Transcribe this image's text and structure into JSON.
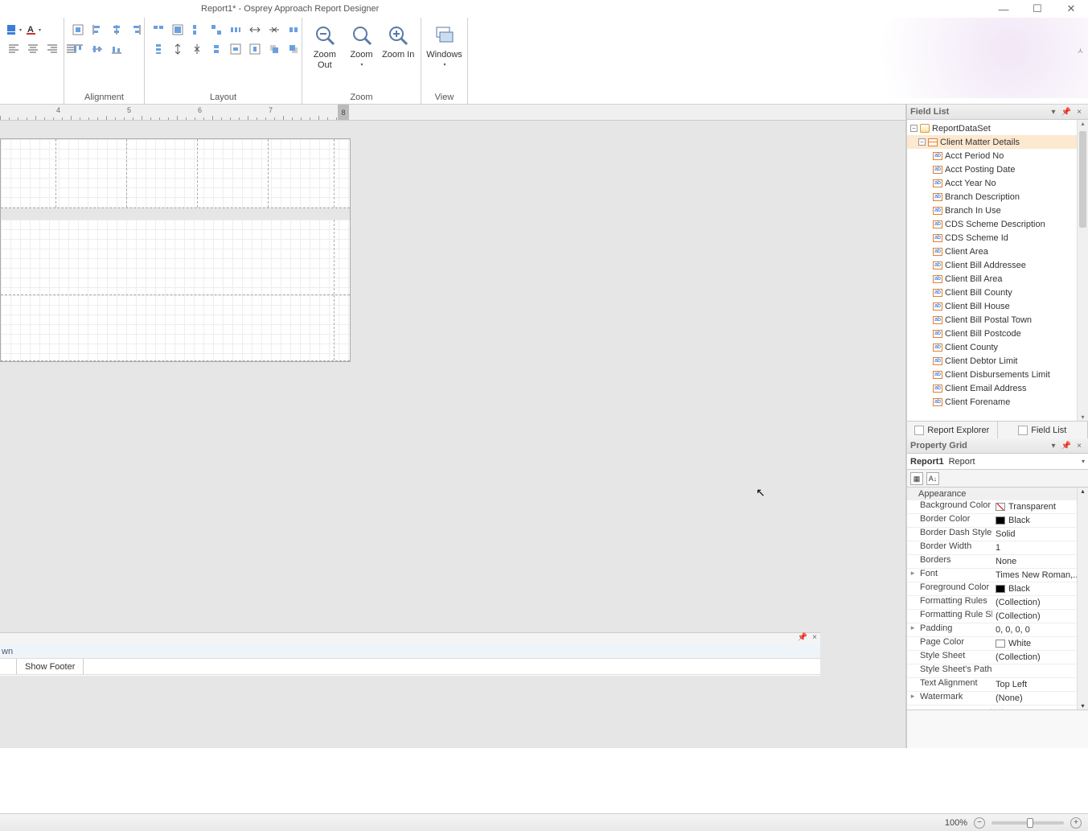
{
  "window": {
    "title": "Report1* - Osprey Approach Report Designer"
  },
  "ribbon": {
    "groups": {
      "alignment": "Alignment",
      "layout": "Layout",
      "zoom": "Zoom",
      "view": "View"
    },
    "zoom_out": "Zoom Out",
    "zoom": "Zoom",
    "zoom_in": "Zoom In",
    "windows": "Windows"
  },
  "ruler": {
    "n4": "4",
    "n5": "5",
    "n6": "6",
    "n7": "7",
    "end": "8"
  },
  "field_list": {
    "title": "Field List",
    "root": "ReportDataSet",
    "table": "Client Matter Details",
    "fields": [
      "Acct Period No",
      "Acct Posting Date",
      "Acct Year No",
      "Branch Description",
      "Branch In Use",
      "CDS Scheme Description",
      "CDS Scheme Id",
      "Client Area",
      "Client Bill Addressee",
      "Client Bill Area",
      "Client Bill County",
      "Client Bill House",
      "Client Bill Postal Town",
      "Client Bill Postcode",
      "Client County",
      "Client Debtor Limit",
      "Client Disbursements Limit",
      "Client Email Address",
      "Client Forename"
    ],
    "tab_explorer": "Report Explorer",
    "tab_fieldlist": "Field List"
  },
  "property_grid": {
    "title": "Property Grid",
    "object_name": "Report1",
    "object_type": "Report",
    "category": "Appearance",
    "rows": [
      {
        "name": "Background Color",
        "value": "Transparent",
        "swatch": "transparent"
      },
      {
        "name": "Border Color",
        "value": "Black",
        "swatch": "black"
      },
      {
        "name": "Border Dash Style",
        "value": "Solid"
      },
      {
        "name": "Border Width",
        "value": "1"
      },
      {
        "name": "Borders",
        "value": "None"
      },
      {
        "name": "Font",
        "value": "Times New Roman,...",
        "expand": true
      },
      {
        "name": "Foreground Color",
        "value": "Black",
        "swatch": "black"
      },
      {
        "name": "Formatting Rules",
        "value": "(Collection)"
      },
      {
        "name": "Formatting Rule Sheet",
        "value": "(Collection)"
      },
      {
        "name": "Padding",
        "value": "0, 0, 0, 0",
        "expand": true
      },
      {
        "name": "Page Color",
        "value": "White",
        "swatch": "white"
      },
      {
        "name": "Style Sheet",
        "value": "(Collection)"
      },
      {
        "name": "Style Sheet's Path",
        "value": ""
      },
      {
        "name": "Text Alignment",
        "value": "Top Left"
      },
      {
        "name": "Watermark",
        "value": "(None)",
        "expand": true
      }
    ]
  },
  "bottom": {
    "tab1": "wn",
    "cell1": "Show Footer"
  },
  "status": {
    "zoom_pct": "100%"
  }
}
